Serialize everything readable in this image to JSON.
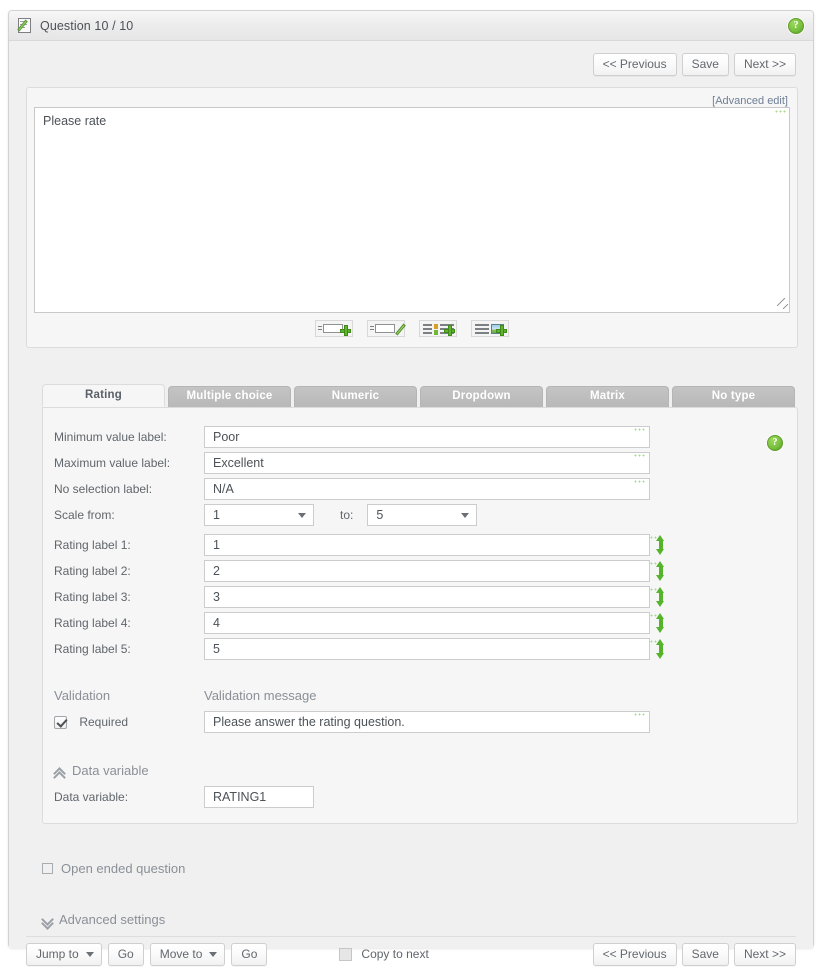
{
  "window": {
    "title": "Question 10 / 10",
    "title_icon": "page-edit-icon",
    "help_icon": "help-circle-icon",
    "help_glyph": "?"
  },
  "topnav": {
    "previous": "<< Previous",
    "save": "Save",
    "next": "Next >>"
  },
  "question_editor": {
    "advanced_edit_link": "[Advanced edit]",
    "question_text": "Please rate",
    "question_placeholder": "",
    "toolbar": [
      {
        "name": "add-text-box-icon",
        "title": "Add text box"
      },
      {
        "name": "edit-text-box-icon",
        "title": "Edit text box"
      },
      {
        "name": "add-list-item-icon",
        "title": "Add list item"
      },
      {
        "name": "add-image-icon",
        "title": "Add image"
      }
    ]
  },
  "tabs": [
    {
      "label": "Rating",
      "active": true
    },
    {
      "label": "Multiple choice",
      "active": false
    },
    {
      "label": "Numeric",
      "active": false
    },
    {
      "label": "Dropdown",
      "active": false
    },
    {
      "label": "Matrix",
      "active": false
    },
    {
      "label": "No type",
      "active": false
    }
  ],
  "rating_panel": {
    "help_glyph": "?",
    "minimum_value_label": {
      "label": "Minimum value label:",
      "value": "Poor"
    },
    "maximum_value_label": {
      "label": "Maximum value label:",
      "value": "Excellent"
    },
    "no_selection_label": {
      "label": "No selection label:",
      "value": "N/A"
    },
    "scale": {
      "label": "Scale from:",
      "from_value": "1",
      "to_label": "to:",
      "to_value": "5"
    },
    "rating_labels": [
      {
        "label": "Rating label 1:",
        "value": "1"
      },
      {
        "label": "Rating label 2:",
        "value": "2"
      },
      {
        "label": "Rating label 3:",
        "value": "3"
      },
      {
        "label": "Rating label 4:",
        "value": "4"
      },
      {
        "label": "Rating label 5:",
        "value": "5"
      }
    ],
    "validation": {
      "heading": "Validation",
      "message_heading": "Validation message",
      "required_label": "Required",
      "required_checked": true,
      "message_value": "Please answer the rating question."
    },
    "data_variable": {
      "section_label": "Data variable",
      "section_chevron": "chevron-double-up-icon",
      "field_label": "Data variable:",
      "value": "RATING1"
    }
  },
  "open_ended": {
    "label": "Open ended question",
    "checked": false
  },
  "advanced_settings": {
    "label": "Advanced settings",
    "chevron": "chevron-double-down-icon"
  },
  "footer": {
    "jump_to": "Jump to",
    "jump_go": "Go",
    "move_to": "Move to",
    "move_go": "Go",
    "copy_to_next": "Copy to next",
    "copy_to_next_checked": false,
    "previous": "<< Previous",
    "save": "Save",
    "next": "Next >>"
  },
  "colors": {
    "accent_green": "#5fb32f",
    "window_bg": "#f0f0f0",
    "panel_bg": "#f6f6f6",
    "tab_inactive": "#bdbdbd",
    "link": "#6f7f96",
    "text": "#60666c"
  }
}
